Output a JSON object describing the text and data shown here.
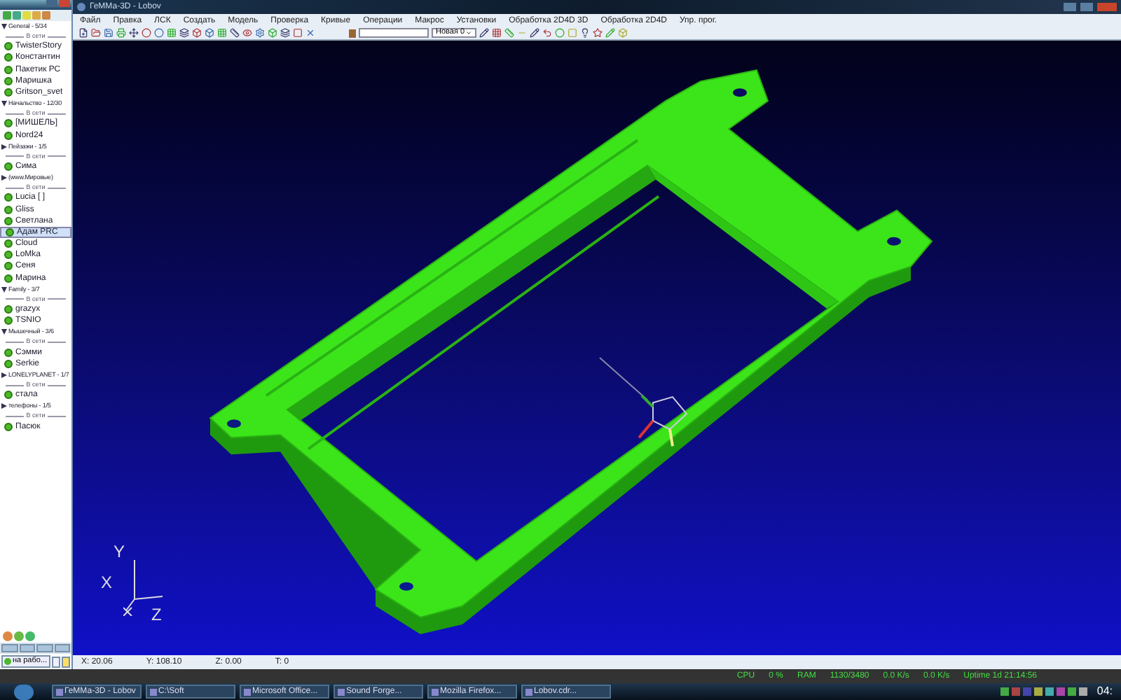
{
  "contact_list": {
    "items": [
      {
        "kind": "group",
        "name": "General - 5/34",
        "expanded": true
      },
      {
        "kind": "separator",
        "name": "В сети"
      },
      {
        "kind": "contact",
        "name": "TwisterStory",
        "selected": false
      },
      {
        "kind": "contact",
        "name": "Константин",
        "selected": false
      },
      {
        "kind": "contact",
        "name": "Пакетик РС",
        "selected": false
      },
      {
        "kind": "contact",
        "name": "Маришка",
        "selected": false
      },
      {
        "kind": "contact",
        "name": "Gritson_svet",
        "selected": false
      },
      {
        "kind": "group",
        "name": "Начальство - 12/30",
        "expanded": true
      },
      {
        "kind": "separator",
        "name": "В сети"
      },
      {
        "kind": "contact",
        "name": "[МИШЕЛЬ]",
        "selected": false
      },
      {
        "kind": "contact",
        "name": "Nord24",
        "selected": false
      },
      {
        "kind": "group",
        "name": "Пейзажи - 1/5",
        "expanded": false
      },
      {
        "kind": "separator",
        "name": "В сети"
      },
      {
        "kind": "contact",
        "name": "Сима",
        "selected": false
      },
      {
        "kind": "group",
        "name": "(www.Мировые)",
        "expanded": false
      },
      {
        "kind": "separator",
        "name": "В сети"
      },
      {
        "kind": "contact",
        "name": "Lucia [ ]",
        "selected": false
      },
      {
        "kind": "contact",
        "name": "Gliss",
        "selected": false
      },
      {
        "kind": "contact",
        "name": "Светлана",
        "selected": false
      },
      {
        "kind": "contact",
        "name": "Адам PRC",
        "selected": true
      },
      {
        "kind": "contact",
        "name": "Cloud",
        "selected": false
      },
      {
        "kind": "contact",
        "name": "LoMka",
        "selected": false
      },
      {
        "kind": "contact",
        "name": "Сеня",
        "selected": false
      },
      {
        "kind": "contact",
        "name": "Марина",
        "selected": false
      },
      {
        "kind": "group",
        "name": "Family - 3/7",
        "expanded": true
      },
      {
        "kind": "separator",
        "name": "В сети"
      },
      {
        "kind": "contact",
        "name": "grazyx",
        "selected": false
      },
      {
        "kind": "contact",
        "name": "TSNIO",
        "selected": false
      },
      {
        "kind": "group",
        "name": "Мышечный - 3/6",
        "expanded": true
      },
      {
        "kind": "separator",
        "name": "В сети"
      },
      {
        "kind": "contact",
        "name": "Сэмми",
        "selected": false
      },
      {
        "kind": "contact",
        "name": "Serkie",
        "selected": false
      },
      {
        "kind": "group",
        "name": "LONELYPLANET - 1/7",
        "expanded": false
      },
      {
        "kind": "separator",
        "name": "В сети"
      },
      {
        "kind": "contact",
        "name": "стала",
        "selected": false
      },
      {
        "kind": "group",
        "name": "телефоны - 1/5",
        "expanded": false
      },
      {
        "kind": "separator",
        "name": "В сети"
      },
      {
        "kind": "contact",
        "name": "Пасюк",
        "selected": false
      }
    ],
    "status_button": "на рабо..."
  },
  "window": {
    "title": "ГеММа-3D - Lobov"
  },
  "menu": [
    "Файл",
    "Правка",
    "ЛСК",
    "Создать",
    "Модель",
    "Проверка",
    "Кривые",
    "Операции",
    "Макрос",
    "Установки",
    "Обработка 2D4D 3D",
    "Обработка 2D4D",
    "Упр. прог."
  ],
  "toolbar": {
    "layer_field": "Новая 0"
  },
  "viewport": {
    "axes": [
      "Y",
      "X",
      "Z"
    ]
  },
  "status_bar": [
    "X: 20.06",
    "Y: 108.10",
    "Z: 0.00",
    "T: 0"
  ],
  "system_bar": [
    "CPU",
    "0 %",
    "RAM",
    "1130/3480",
    "0.0 K/s",
    "0.0 K/s",
    "Uptime 1d 21:14:56"
  ],
  "taskbar": {
    "items": [
      "ГеММа-3D - Lobov",
      "C:\\Soft",
      "Microsoft Office...",
      "Sound Forge...",
      "Mozilla Firefox...",
      "Lobov.cdr..."
    ],
    "clock": "04:"
  }
}
